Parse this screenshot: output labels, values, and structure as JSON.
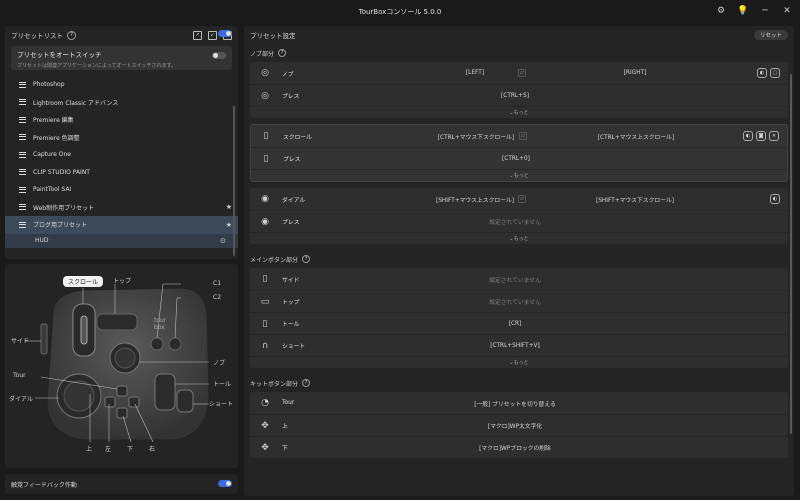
{
  "window": {
    "title": "TourBoxコンソール 5.0.0"
  },
  "left": {
    "preset_header": "プリセットリスト",
    "autoswitch": {
      "title": "プリセットをオートスイッチ",
      "desc": "プリセットは関連アプリケーションによってオートスイッチされます。"
    },
    "presets": [
      {
        "label": "Photoshop",
        "star": false
      },
      {
        "label": "Lightroom Classic アドバンス",
        "star": false
      },
      {
        "label": "Premiere 編集",
        "star": false
      },
      {
        "label": "Premiere 色調整",
        "star": false
      },
      {
        "label": "Capture One",
        "star": false
      },
      {
        "label": "CLIP STUDIO PAINT",
        "star": false
      },
      {
        "label": "PaintTool SAI",
        "star": false
      },
      {
        "label": "Web制作用プリセット",
        "star": true
      },
      {
        "label": "ブログ用プリセット",
        "star": true
      }
    ],
    "hud_label": "HUD",
    "device_labels": {
      "scroll": "スクロール",
      "top": "トップ",
      "c1": "C1",
      "c2": "C2",
      "side": "サイド",
      "knob": "ノブ",
      "tour": "Tour",
      "tall": "トール",
      "dial": "ダイアル",
      "short": "ショート",
      "up": "上",
      "left": "左",
      "down": "下",
      "right": "右"
    },
    "haptic_label": "触覚フィードバック作動"
  },
  "right": {
    "header": "プリセット設定",
    "reset_label": "リセット",
    "more_label": "もっと",
    "knob_section": {
      "title": "ノブ部分",
      "groups": [
        {
          "rows": [
            {
              "icon": "knob-icon",
              "name": "ノブ",
              "left": "[LEFT]",
              "right": "[RIGHT]",
              "actions": [
                "◐",
                "▢"
              ]
            },
            {
              "icon": "knob-press-icon",
              "name": "プレス",
              "center": "[CTRL+S]"
            }
          ]
        },
        {
          "rows": [
            {
              "icon": "scroll-icon",
              "name": "スクロール",
              "left": "[CTRL+マウス下スクロール]",
              "right": "[CTRL+マウス上スクロール]",
              "actions": [
                "◐",
                "◙",
                "✕"
              ]
            },
            {
              "icon": "scroll-press-icon",
              "name": "プレス",
              "center": "[CTRL+0]"
            }
          ]
        },
        {
          "rows": [
            {
              "icon": "dial-icon",
              "name": "ダイアル",
              "left": "[SHIFT+マウス上スクロール]",
              "right": "[SHIFT+マウス下スクロール]",
              "actions": [
                "◐"
              ]
            },
            {
              "icon": "dial-press-icon",
              "name": "プレス",
              "center": "設定されていません",
              "dim": true
            }
          ]
        }
      ]
    },
    "main_section": {
      "title": "メインボタン部分",
      "rows": [
        {
          "icon": "side-icon",
          "name": "サイド",
          "center": "設定されていません",
          "dim": true
        },
        {
          "icon": "top-icon",
          "name": "トップ",
          "center": "設定されていません",
          "dim": true
        },
        {
          "icon": "tall-icon",
          "name": "トール",
          "center": "[CR]"
        },
        {
          "icon": "short-icon",
          "name": "ショート",
          "center": "[CTRL+SHIFT+V]"
        }
      ]
    },
    "kit_section": {
      "title": "キットボタン部分",
      "rows": [
        {
          "icon": "tour-icon",
          "name": "Tour",
          "center": "[一般] プリセットを切り替える"
        },
        {
          "icon": "dpad-up-icon",
          "name": "上",
          "center": "[マクロ]WP太文字化"
        },
        {
          "icon": "dpad-down-icon",
          "name": "下",
          "center": "[マクロ]WPブロックの削除"
        }
      ]
    }
  }
}
